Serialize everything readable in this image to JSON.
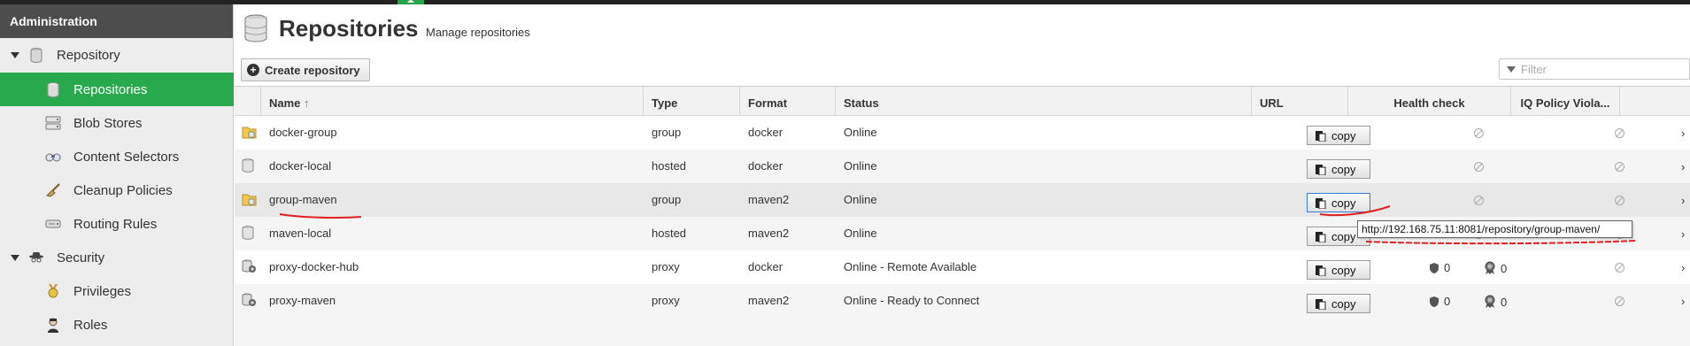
{
  "sidebar": {
    "title": "Administration",
    "items": [
      {
        "label": "Repository",
        "icon": "database-icon",
        "level": 0,
        "expanded": true
      },
      {
        "label": "Repositories",
        "icon": "database-icon",
        "level": 1,
        "active": true
      },
      {
        "label": "Blob Stores",
        "icon": "server-icon",
        "level": 1
      },
      {
        "label": "Content Selectors",
        "icon": "binoculars-icon",
        "level": 1
      },
      {
        "label": "Cleanup Policies",
        "icon": "broom-icon",
        "level": 1
      },
      {
        "label": "Routing Rules",
        "icon": "drive-icon",
        "level": 1
      },
      {
        "label": "Security",
        "icon": "spy-icon",
        "level": 0,
        "expanded": true
      },
      {
        "label": "Privileges",
        "icon": "medal-icon",
        "level": 1
      },
      {
        "label": "Roles",
        "icon": "user-tie-icon",
        "level": 1
      }
    ]
  },
  "header": {
    "title": "Repositories",
    "subtitle": "Manage repositories",
    "icon": "database-icon"
  },
  "toolbar": {
    "create_label": "Create repository",
    "filter_placeholder": "Filter"
  },
  "grid": {
    "columns": {
      "name": "Name",
      "type": "Type",
      "format": "Format",
      "status": "Status",
      "url": "URL",
      "health": "Health check",
      "iq": "IQ Policy Viola..."
    },
    "sort_indicator": "↑",
    "copy_label": "copy",
    "rows": [
      {
        "name": "docker-group",
        "type": "group",
        "format": "docker",
        "status": "Online",
        "icon": "folder-db-icon",
        "health": null
      },
      {
        "name": "docker-local",
        "type": "hosted",
        "format": "docker",
        "status": "Online",
        "icon": "database-icon",
        "health": null
      },
      {
        "name": "group-maven",
        "type": "group",
        "format": "maven2",
        "status": "Online",
        "icon": "folder-db-icon",
        "health": null,
        "selected": true
      },
      {
        "name": "maven-local",
        "type": "hosted",
        "format": "maven2",
        "status": "Online",
        "icon": "database-icon",
        "health": null
      },
      {
        "name": "proxy-docker-hub",
        "type": "proxy",
        "format": "docker",
        "status": "Online - Remote Available",
        "icon": "proxy-icon",
        "health": {
          "security": "0",
          "license": "0"
        }
      },
      {
        "name": "proxy-maven",
        "type": "proxy",
        "format": "maven2",
        "status": "Online - Ready to Connect",
        "icon": "proxy-icon",
        "health": {
          "security": "0",
          "license": "0"
        }
      }
    ]
  },
  "tooltip": {
    "text": "http://192.168.75.11:8081/repository/group-maven/"
  },
  "colors": {
    "active_green": "#28a94d",
    "annotation_red": "#e02020",
    "sidebar_title_bg": "#4d4d4d"
  }
}
